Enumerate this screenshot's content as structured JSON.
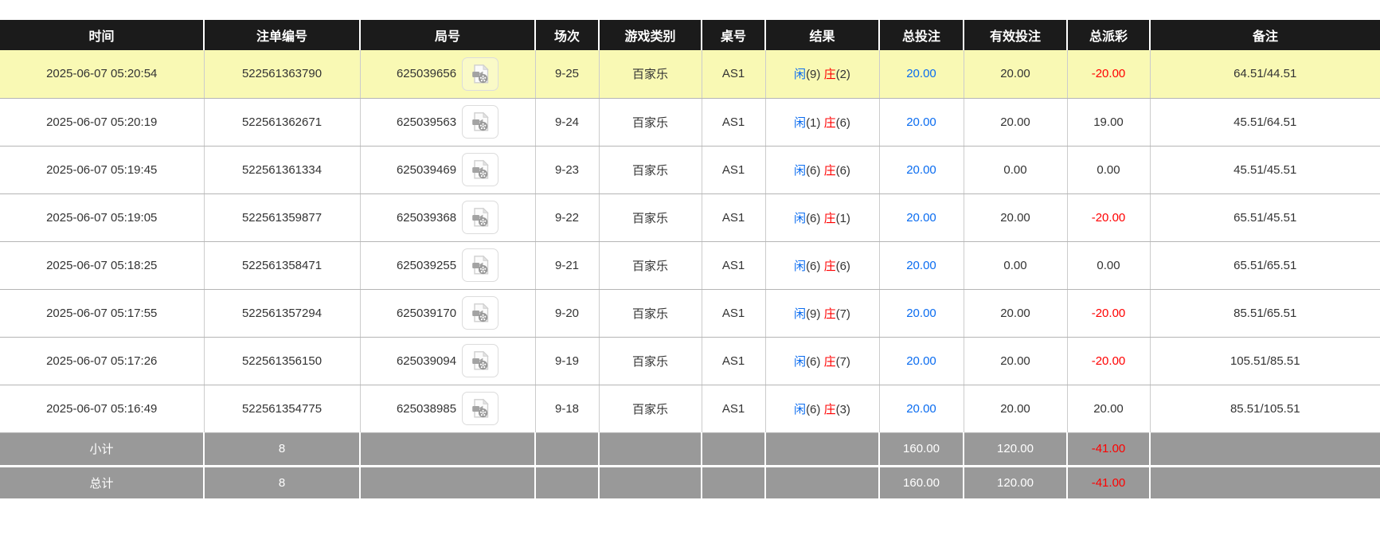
{
  "page": {
    "background": "#ffffff"
  },
  "colors": {
    "header_bg": "#1b1b1b",
    "header_text": "#ffffff",
    "highlight_row_bg": "#f9f9b4",
    "summary_row_bg": "#999999",
    "summary_text": "#ffffff",
    "player_blue": "#0a6cf0",
    "banker_red": "#ff0000",
    "bet_amount_blue": "#0a6cf0",
    "negative_amount_red": "#ff0000",
    "body_text": "#333333",
    "grid_line": "#cccccc"
  },
  "icons": {
    "video_replay": "video-file-icon"
  },
  "table": {
    "columns": [
      {
        "label": "时间"
      },
      {
        "label": "注单编号"
      },
      {
        "label": "局号"
      },
      {
        "label": "场次"
      },
      {
        "label": "游戏类别"
      },
      {
        "label": "桌号"
      },
      {
        "label": "结果"
      },
      {
        "label": "总投注"
      },
      {
        "label": "有效投注"
      },
      {
        "label": "总派彩"
      },
      {
        "label": "备注"
      }
    ],
    "rows": [
      {
        "time": "2025-06-07 05:20:54",
        "bet_id": "522561363790",
        "round_id": "625039656",
        "session": "9-25",
        "game_type": "百家乐",
        "table_no": "AS1",
        "result": {
          "player_label": "闲",
          "player_points": "(9)",
          "banker_label": "庄",
          "banker_points": "(2)"
        },
        "total_bet": "20.00",
        "valid_bet": "20.00",
        "payout": "-20.00",
        "remark": "64.51/44.51",
        "highlighted": true
      },
      {
        "time": "2025-06-07 05:20:19",
        "bet_id": "522561362671",
        "round_id": "625039563",
        "session": "9-24",
        "game_type": "百家乐",
        "table_no": "AS1",
        "result": {
          "player_label": "闲",
          "player_points": "(1)",
          "banker_label": "庄",
          "banker_points": "(6)"
        },
        "total_bet": "20.00",
        "valid_bet": "20.00",
        "payout": "19.00",
        "remark": "45.51/64.51",
        "highlighted": false
      },
      {
        "time": "2025-06-07 05:19:45",
        "bet_id": "522561361334",
        "round_id": "625039469",
        "session": "9-23",
        "game_type": "百家乐",
        "table_no": "AS1",
        "result": {
          "player_label": "闲",
          "player_points": "(6)",
          "banker_label": "庄",
          "banker_points": "(6)"
        },
        "total_bet": "20.00",
        "valid_bet": "0.00",
        "payout": "0.00",
        "remark": "45.51/45.51",
        "highlighted": false
      },
      {
        "time": "2025-06-07 05:19:05",
        "bet_id": "522561359877",
        "round_id": "625039368",
        "session": "9-22",
        "game_type": "百家乐",
        "table_no": "AS1",
        "result": {
          "player_label": "闲",
          "player_points": "(6)",
          "banker_label": "庄",
          "banker_points": "(1)"
        },
        "total_bet": "20.00",
        "valid_bet": "20.00",
        "payout": "-20.00",
        "remark": "65.51/45.51",
        "highlighted": false
      },
      {
        "time": "2025-06-07 05:18:25",
        "bet_id": "522561358471",
        "round_id": "625039255",
        "session": "9-21",
        "game_type": "百家乐",
        "table_no": "AS1",
        "result": {
          "player_label": "闲",
          "player_points": "(6)",
          "banker_label": "庄",
          "banker_points": "(6)"
        },
        "total_bet": "20.00",
        "valid_bet": "0.00",
        "payout": "0.00",
        "remark": "65.51/65.51",
        "highlighted": false
      },
      {
        "time": "2025-06-07 05:17:55",
        "bet_id": "522561357294",
        "round_id": "625039170",
        "session": "9-20",
        "game_type": "百家乐",
        "table_no": "AS1",
        "result": {
          "player_label": "闲",
          "player_points": "(9)",
          "banker_label": "庄",
          "banker_points": "(7)"
        },
        "total_bet": "20.00",
        "valid_bet": "20.00",
        "payout": "-20.00",
        "remark": "85.51/65.51",
        "highlighted": false
      },
      {
        "time": "2025-06-07 05:17:26",
        "bet_id": "522561356150",
        "round_id": "625039094",
        "session": "9-19",
        "game_type": "百家乐",
        "table_no": "AS1",
        "result": {
          "player_label": "闲",
          "player_points": "(6)",
          "banker_label": "庄",
          "banker_points": "(7)"
        },
        "total_bet": "20.00",
        "valid_bet": "20.00",
        "payout": "-20.00",
        "remark": "105.51/85.51",
        "highlighted": false
      },
      {
        "time": "2025-06-07 05:16:49",
        "bet_id": "522561354775",
        "round_id": "625038985",
        "session": "9-18",
        "game_type": "百家乐",
        "table_no": "AS1",
        "result": {
          "player_label": "闲",
          "player_points": "(6)",
          "banker_label": "庄",
          "banker_points": "(3)"
        },
        "total_bet": "20.00",
        "valid_bet": "20.00",
        "payout": "20.00",
        "remark": "85.51/105.51",
        "highlighted": false
      }
    ],
    "subtotal": {
      "label": "小计",
      "count": "8",
      "total_bet": "160.00",
      "valid_bet": "120.00",
      "payout": "-41.00",
      "remark": ""
    },
    "total": {
      "label": "总计",
      "count": "8",
      "total_bet": "160.00",
      "valid_bet": "120.00",
      "payout": "-41.00",
      "remark": ""
    }
  }
}
